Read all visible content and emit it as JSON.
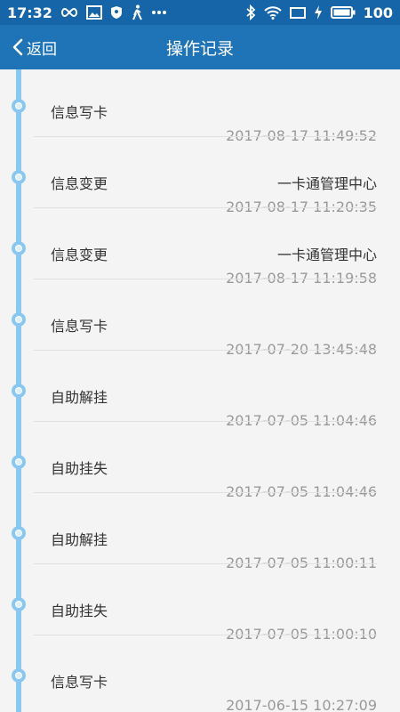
{
  "status_bar": {
    "time": "17:32",
    "battery": "100",
    "left_icons": [
      "infinity-icon",
      "image-icon",
      "shield-icon",
      "walk-icon",
      "more-icon"
    ],
    "right_icons": [
      "bluetooth-icon",
      "wifi-icon",
      "window-icon",
      "charging-icon",
      "battery-icon"
    ]
  },
  "header": {
    "back_label": "返回",
    "title": "操作记录"
  },
  "records": [
    {
      "action": "信息写卡",
      "org": "",
      "time": "2017-08-17 11:49:52"
    },
    {
      "action": "信息变更",
      "org": "一卡通管理中心",
      "time": "2017-08-17 11:20:35"
    },
    {
      "action": "信息变更",
      "org": "一卡通管理中心",
      "time": "2017-08-17 11:19:58"
    },
    {
      "action": "信息写卡",
      "org": "",
      "time": "2017-07-20 13:45:48"
    },
    {
      "action": "自助解挂",
      "org": "",
      "time": "2017-07-05 11:04:46"
    },
    {
      "action": "自助挂失",
      "org": "",
      "time": "2017-07-05 11:04:46"
    },
    {
      "action": "自助解挂",
      "org": "",
      "time": "2017-07-05 11:00:11"
    },
    {
      "action": "自助挂失",
      "org": "",
      "time": "2017-07-05 11:00:10"
    },
    {
      "action": "信息写卡",
      "org": "",
      "time": "2017-06-15 10:27:09"
    }
  ],
  "colors": {
    "status_bar": "#1565a8",
    "app_bar": "#1f74b8",
    "timeline": "#8ac8ef",
    "time_text": "#999999"
  }
}
